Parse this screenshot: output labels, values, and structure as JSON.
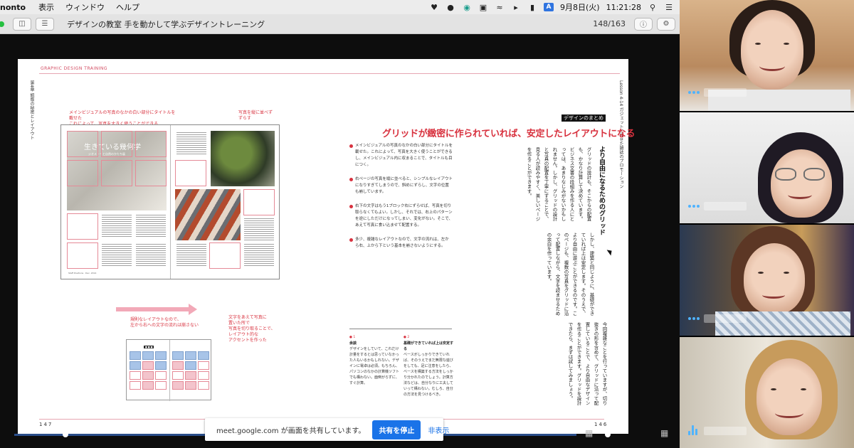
{
  "menubar": {
    "app_name": "nonto",
    "menus": [
      "表示",
      "ウィンドウ",
      "ヘルプ"
    ],
    "date": "9月8日(火)",
    "time": "11:21:28",
    "icons": [
      "shield-icon",
      "creative-cloud-icon",
      "teal-app-icon",
      "wifi-icon",
      "volume-icon",
      "battery-icon",
      "input-source-icon",
      "search-icon",
      "control-center-icon"
    ],
    "input_source": "A"
  },
  "toolbar": {
    "title": "デザインの教室 手を動かして学ぶデザイントレーニング",
    "page_counter": "148/163"
  },
  "book": {
    "running_header": "GRAPHIC DESIGN TRAINING",
    "left_side_text": "第4章 組版の秘密とレイアウト",
    "right_side_text": "Lesson 4-14 ガジェットに任せた雑誌のプロモーション",
    "thumb_title": "生きている幾何学",
    "thumb_subtitle": "ジオメトリと自然のかたち展",
    "note_top_left": "メインビジュアルの写真のなかの白い部分にタイトルを載せた\nこれによって、写真を大きく使うことができる",
    "note_top_right": "写真を縦に並べず\nずらす",
    "note_bottom_left": "規則なレイアウトなので、\n左から右への文字の流れは崩さない",
    "note_bottom_right": "文字をあえて写真に\n置いた所で\n写真を切り取ることで、\nレイアウト的な\nアクセントを作った",
    "bullets": [
      "メインビジュアルの写真のなかの白い部分にタイトルを載せた。これによって、写真を大きく使うことができるし、メインビジュアル内に収まることで、タイトルも目につく。",
      "右ページの写真を縦に並べると、シンプルなレイアウトになりすぎてしまうので、斜めにずらし、文字の位置も崩しています。",
      "右下の文字はもう1ブロック右にずらせば、写真を切り取らなくてもよい。しかし、それでは、右上のパターンを逆にしただけになってしまい、変化がない。そこで、あえて写真に食い込ませて配置する。",
      "多少、複雑なレイアウトなので、文字の流れは、左から右、上から下という基本を崩さないようにする。"
    ],
    "note_a_num": "● 1",
    "note_a_title": "余談",
    "note_a_body": "デザインをしていて、これだけ計量をするとは思っていなかった人もいるかもしれない。デザインに電卓は必須。もちろん、パソコンのなかの計算機ソフトでも構わない。面倒がらずに、すぐ計算。",
    "note_b_num": "● 2",
    "note_b_title": "基礎ができていれば上は安定する",
    "note_b_body": "ベースがしっかりできていれば、そのうえでまだ無限な遊びをしても、足に注意をしたら、ベースを構築する方法をしっかり分かれたのでしょう。計算方法などは、自分なりに工夫していって構わない。むしろ、自分の方法を見つけるべき。",
    "summary_tag": "デザインのまとめ",
    "headline": "グリッドが緻密に作られていれば、安定したレイアウトになる",
    "vertical_heading": "より自由になるためのグリッド",
    "vertical_body_1": "グリッドの設計も、そこからの配置も、かなり計算して決めています。ビジネス文書の段組みを作る人にとっては、あまりなじみがないかもしれません。しかし、グリッドの設計と写真の配置を丁寧にすることで、見る人が読みやすく、美しいページを作ることができます。",
    "vertical_body_2": "しかし、建築と同じように、基礎ができていれば上は安定します。そのうえで、より自由に遊ぶことができるのです。このページも、複数の写真をグリッドに沿って配置しながら、文字を読ませるための余白を作っています。",
    "vertical_body_3": "今回複雑なことを行っていますが、切り抜きの形を含めて、グリッドに沿って配置していることで、より自由なデザインを作ることができます。グリッドを設計できたら、まずは試してみましょう。",
    "page_left": "147",
    "page_right": "146",
    "credit": "Staff Positions · Dec. 2014"
  },
  "share_bar": {
    "message": "meet.google.com が画面を共有しています。",
    "stop_label": "共有を停止",
    "hide_label": "非表示"
  },
  "colors": {
    "accent_red": "#d8323f",
    "grid_pink": "#e58a97",
    "meet_blue": "#1a73e8",
    "audio_indicator": "#4fb3ff"
  },
  "participants": [
    {
      "id": "participant-1",
      "speaking": false
    },
    {
      "id": "participant-2",
      "speaking": false
    },
    {
      "id": "participant-3",
      "speaking": false
    },
    {
      "id": "participant-4",
      "speaking": true
    }
  ]
}
